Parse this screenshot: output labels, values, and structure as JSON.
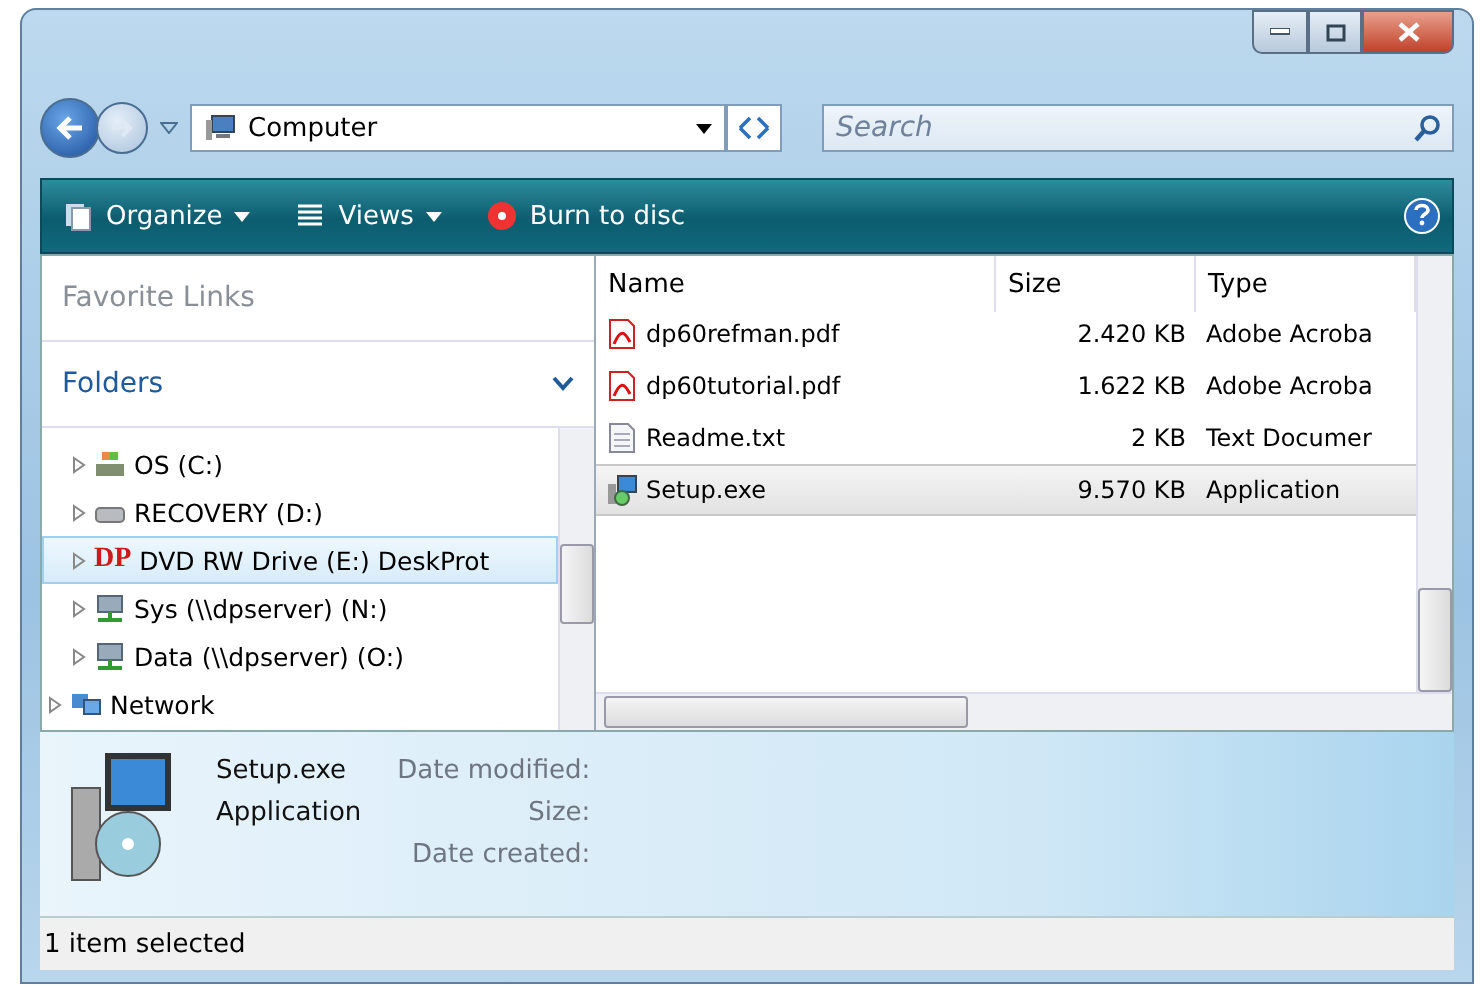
{
  "address": {
    "location": "Computer",
    "search": {
      "placeholder": "Search"
    }
  },
  "toolbar": [
    {
      "label": "Organize",
      "kind": "organize",
      "has_menu": true
    },
    {
      "label": "Views",
      "kind": "views",
      "has_menu": true
    },
    {
      "label": "Burn to disc",
      "kind": "burn",
      "has_menu": false
    }
  ],
  "nav_pane": {
    "favorite_links": "Favorite Links",
    "folders": "Folders",
    "drives": [
      {
        "label": "OS (C:)",
        "kind": "os",
        "selected": false
      },
      {
        "label": "RECOVERY (D:)",
        "kind": "disk",
        "selected": false
      },
      {
        "label": "DVD RW Drive (E:) DeskProt",
        "kind": "dp",
        "badge": "DP",
        "selected": true
      },
      {
        "label": "Sys (\\\\dpserver) (N:)",
        "kind": "net",
        "selected": false
      },
      {
        "label": "Data (\\\\dpserver) (O:)",
        "kind": "net",
        "selected": false
      }
    ],
    "root_items": [
      {
        "label": "Network",
        "kind": "network",
        "selected": false
      }
    ]
  },
  "files": {
    "columns": [
      "Name",
      "Size",
      "Type"
    ],
    "rows": [
      {
        "name": "dp60refman.pdf",
        "size": "2.420 KB",
        "type": "Adobe Acroba",
        "kind": "pdf",
        "selected": false
      },
      {
        "name": "dp60tutorial.pdf",
        "size": "1.622 KB",
        "type": "Adobe Acroba",
        "kind": "pdf",
        "selected": false
      },
      {
        "name": "Readme.txt",
        "size": "2 KB",
        "type": "Text Documer",
        "kind": "txt",
        "selected": false
      },
      {
        "name": "Setup.exe",
        "size": "9.570 KB",
        "type": "Application",
        "kind": "exe",
        "selected": true
      }
    ]
  },
  "details": {
    "name": "Setup.exe",
    "type": "Application",
    "fields": [
      "Date modified:",
      "Size:",
      "Date created:"
    ]
  },
  "status_bar": "1 item selected"
}
